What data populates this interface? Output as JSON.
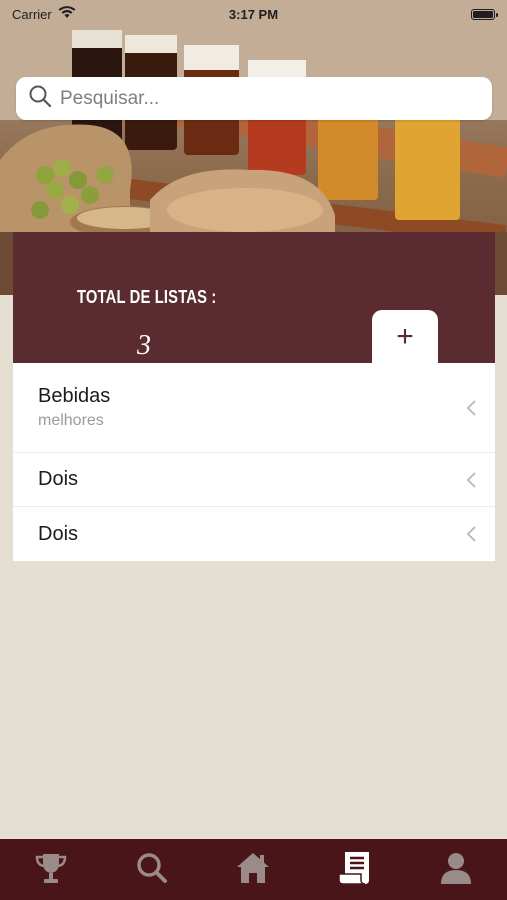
{
  "status_bar": {
    "carrier": "Carrier",
    "time": "3:17 PM"
  },
  "search": {
    "placeholder": "Pesquisar...",
    "value": ""
  },
  "summary": {
    "total_label": "TOTAL DE LISTAS :",
    "total_count": "3",
    "add_label": "+"
  },
  "lists": {
    "items": [
      {
        "title": "Bebidas",
        "subtitle": "melhores"
      },
      {
        "title": "Dois",
        "subtitle": ""
      },
      {
        "title": "Dois",
        "subtitle": ""
      }
    ]
  },
  "tab_bar": {
    "tabs": [
      {
        "icon": "trophy-icon",
        "active": false
      },
      {
        "icon": "search-icon",
        "active": false
      },
      {
        "icon": "home-icon",
        "active": false
      },
      {
        "icon": "list-icon",
        "active": true
      },
      {
        "icon": "user-icon",
        "active": false
      }
    ]
  },
  "colors": {
    "panel": "#5a2c31",
    "tab_bar": "#4a1519",
    "background": "#e4dfd0",
    "tab_icon_inactive": "#9a8a8a",
    "tab_icon_active": "#ffffff"
  }
}
